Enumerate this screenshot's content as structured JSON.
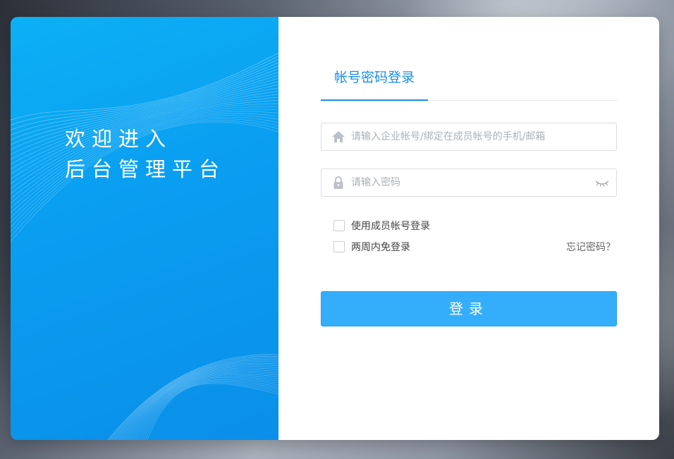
{
  "welcome": {
    "line1": "欢迎进入",
    "line2": "后台管理平台"
  },
  "tabs": [
    {
      "label": "帐号密码登录",
      "active": true
    }
  ],
  "account_field": {
    "icon": "home-icon",
    "placeholder": "请输入企业帐号/绑定在成员帐号的手机/邮箱",
    "value": ""
  },
  "password_field": {
    "icon": "lock-icon",
    "placeholder": "请输入密码",
    "value": "",
    "toggle_icon": "eye-closed-icon"
  },
  "options": {
    "member_login_label": "使用成员帐号登录",
    "member_login_checked": false,
    "remember_label": "两周内免登录",
    "remember_checked": false,
    "forgot_label": "忘记密码？"
  },
  "login_button": {
    "label": "登录"
  },
  "colors": {
    "accent": "#1a8fe6",
    "button": "#34aefb",
    "panel_top": "#0cb0f5",
    "panel_bottom": "#0a8fe8"
  }
}
